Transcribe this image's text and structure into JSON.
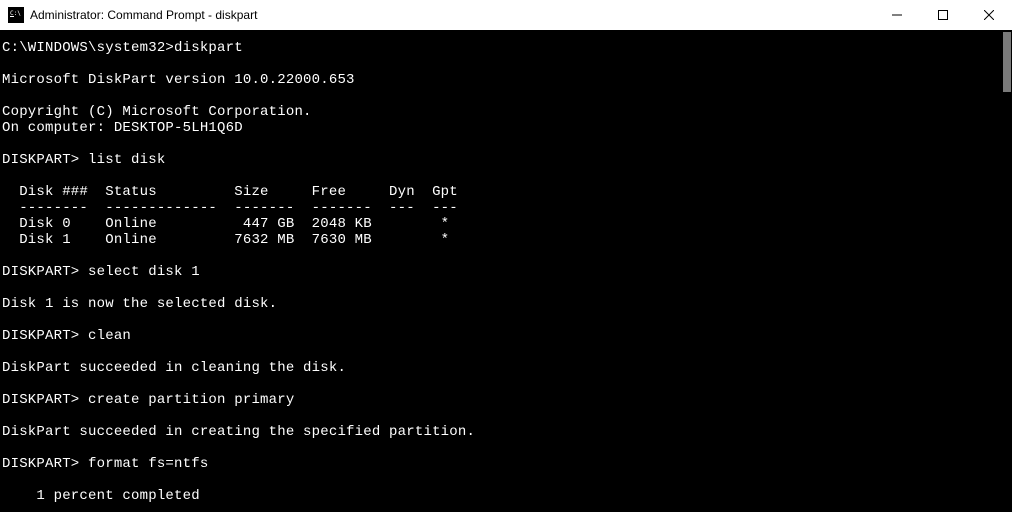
{
  "titlebar": {
    "text": "Administrator: Command Prompt - diskpart"
  },
  "terminal": {
    "lines": [
      "C:\\WINDOWS\\system32>diskpart",
      "",
      "Microsoft DiskPart version 10.0.22000.653",
      "",
      "Copyright (C) Microsoft Corporation.",
      "On computer: DESKTOP-5LH1Q6D",
      "",
      "DISKPART> list disk",
      "",
      "  Disk ###  Status         Size     Free     Dyn  Gpt",
      "  --------  -------------  -------  -------  ---  ---",
      "  Disk 0    Online          447 GB  2048 KB        *",
      "  Disk 1    Online         7632 MB  7630 MB        *",
      "",
      "DISKPART> select disk 1",
      "",
      "Disk 1 is now the selected disk.",
      "",
      "DISKPART> clean",
      "",
      "DiskPart succeeded in cleaning the disk.",
      "",
      "DISKPART> create partition primary",
      "",
      "DiskPart succeeded in creating the specified partition.",
      "",
      "DISKPART> format fs=ntfs",
      "",
      "    1 percent completed"
    ]
  },
  "disk_table": {
    "headers": [
      "Disk ###",
      "Status",
      "Size",
      "Free",
      "Dyn",
      "Gpt"
    ],
    "rows": [
      {
        "disk": "Disk 0",
        "status": "Online",
        "size": "447 GB",
        "free": "2048 KB",
        "dyn": "",
        "gpt": "*"
      },
      {
        "disk": "Disk 1",
        "status": "Online",
        "size": "7632 MB",
        "free": "7630 MB",
        "dyn": "",
        "gpt": "*"
      }
    ]
  },
  "diskpart": {
    "version": "10.0.22000.653",
    "computer": "DESKTOP-5LH1Q6D",
    "prompt": "DISKPART>",
    "initial_prompt": "C:\\WINDOWS\\system32>",
    "commands": [
      "diskpart",
      "list disk",
      "select disk 1",
      "clean",
      "create partition primary",
      "format fs=ntfs"
    ],
    "format_progress": "1 percent completed"
  }
}
